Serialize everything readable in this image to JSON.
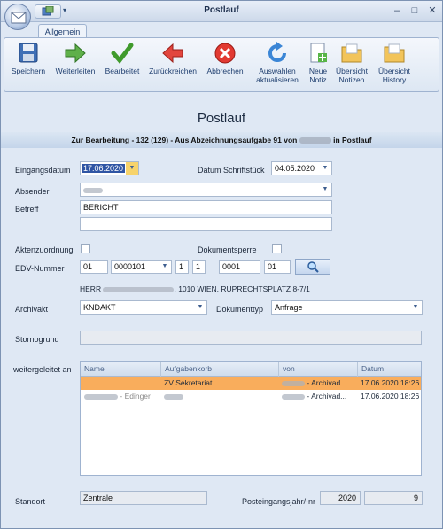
{
  "window": {
    "title": "Postlauf"
  },
  "ribbon": {
    "tab": "Allgemein",
    "buttons": [
      {
        "label1": "Speichern",
        "label2": "",
        "icon": "save-icon"
      },
      {
        "label1": "Weiterleiten",
        "label2": "",
        "icon": "forward-arrow-icon"
      },
      {
        "label1": "Bearbeitet",
        "label2": "",
        "icon": "checkmark-icon"
      },
      {
        "label1": "Zurückreichen",
        "label2": "",
        "icon": "back-arrow-icon"
      },
      {
        "label1": "Abbrechen",
        "label2": "",
        "icon": "cancel-icon"
      },
      {
        "label1": "Auswahlen",
        "label2": "aktualisieren",
        "icon": "refresh-icon"
      },
      {
        "label1": "Neue",
        "label2": "Notiz",
        "icon": "new-note-icon"
      },
      {
        "label1": "Übersicht",
        "label2": "Notizen",
        "icon": "folder-notes-icon"
      },
      {
        "label1": "Übersicht",
        "label2": "History",
        "icon": "folder-history-icon"
      }
    ]
  },
  "header": {
    "title": "Postlauf",
    "subtitle_part1": "Zur Bearbeitung - 132 (129) - Aus Abzeichnungsaufgabe 91 von",
    "subtitle_part2": "in Postlauf"
  },
  "form": {
    "eingangsdatum_label": "Eingangsdatum",
    "eingangsdatum_value": "17.06.2020",
    "datum_schriftstueck_label": "Datum Schriftstück",
    "datum_schriftstueck_value": "04.05.2020",
    "absender_label": "Absender",
    "betreff_label": "Betreff",
    "betreff_value": "BERICHT",
    "aktenzuordnung_label": "Aktenzuordnung",
    "dokumentsperre_label": "Dokumentsperre",
    "edv_label": "EDV-Nummer",
    "edv_1": "01",
    "edv_2": "0000101",
    "edv_3": "1",
    "edv_4": "1",
    "edv_5": "0001",
    "edv_6": "01",
    "address_prefix": "HERR",
    "address_suffix": ", 1010 WIEN, RUPRECHTSPLATZ 8-7/1",
    "archivakt_label": "Archivakt",
    "archivakt_value": "KNDAKT",
    "dokumenttyp_label": "Dokumenttyp",
    "dokumenttyp_value": "Anfrage",
    "stornogrund_label": "Stornogrund",
    "weitergeleitet_label": "weitergeleitet an",
    "standort_label": "Standort",
    "standort_value": "Zentrale",
    "posteingang_label": "Posteingangsjahr/-nr",
    "posteingang_jahr": "2020",
    "posteingang_nr": "9"
  },
  "grid": {
    "columns": [
      "Name",
      "Aufgabenkorb",
      "von",
      "Datum"
    ],
    "rows": [
      {
        "name": "",
        "korb": "ZV Sekretariat",
        "von": "- Archivad...",
        "datum": "17.06.2020 18:26"
      },
      {
        "name": "- Edinger",
        "korb": "",
        "von": "- Archivad...",
        "datum": "17.06.2020 18:26"
      }
    ]
  },
  "colors": {
    "accent": "#2f55a4",
    "row_highlight": "#f9ad5c",
    "background": "#dfe8f4"
  }
}
